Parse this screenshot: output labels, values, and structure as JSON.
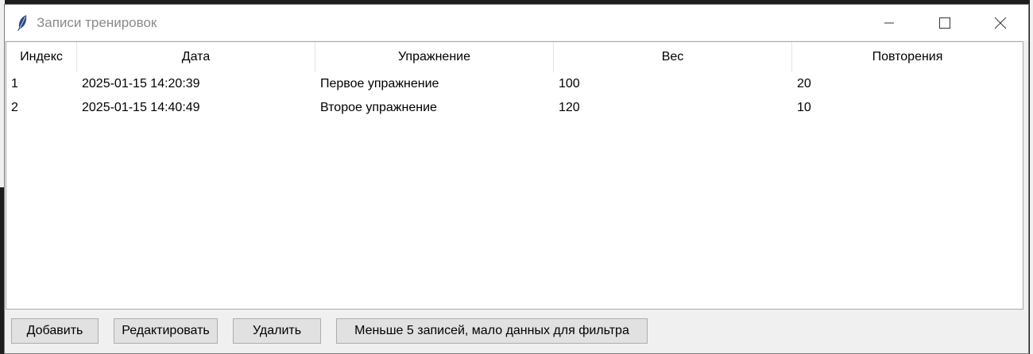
{
  "window": {
    "title": "Записи тренировок",
    "icon": "feather-icon",
    "controls": [
      "minimize-icon",
      "maximize-icon",
      "close-icon"
    ]
  },
  "table": {
    "columns": [
      "Индекс",
      "Дата",
      "Упражнение",
      "Вес",
      "Повторения"
    ],
    "rows": [
      [
        "1",
        "2025-01-15 14:20:39",
        "Первое упражнение",
        "100",
        "20"
      ],
      [
        "2",
        "2025-01-15 14:40:49",
        "Второе упражнение",
        "120",
        "10"
      ]
    ]
  },
  "buttons": {
    "add": "Добавить",
    "edit": "Редактировать",
    "delete": "Удалить",
    "filter": "Меньше 5 записей, мало данных для фильтра"
  }
}
